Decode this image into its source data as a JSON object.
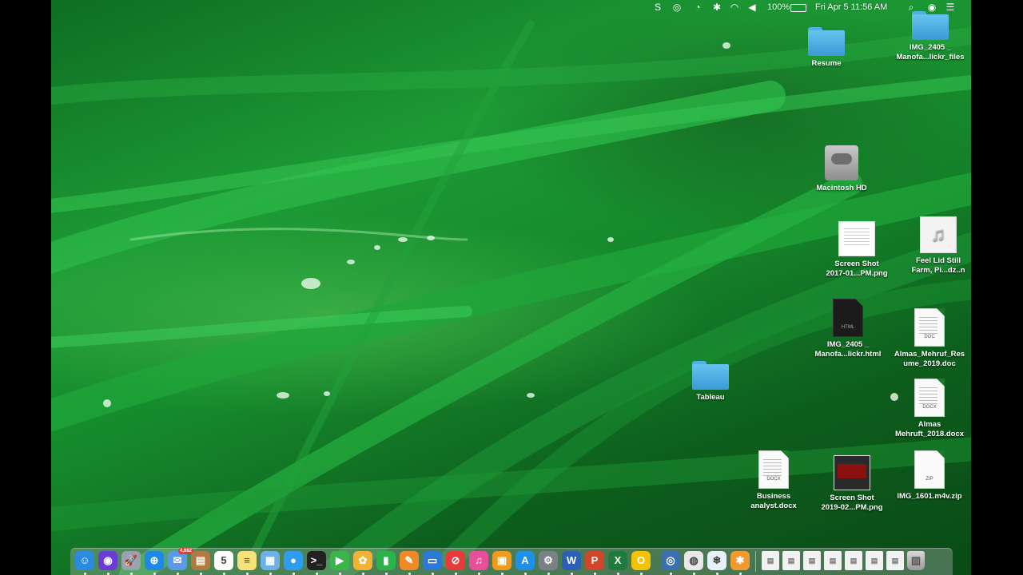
{
  "menubar": {
    "battery": "100%",
    "datetime": "Fri Apr 5  11:56 AM"
  },
  "desktop": {
    "icons": [
      {
        "label": "Resume",
        "type": "folder"
      },
      {
        "label": "IMG_2405 _\nManofa...lickr_files",
        "type": "folder"
      },
      {
        "label": "Macintosh HD",
        "type": "drive"
      },
      {
        "label": "Screen Shot\n2017-01...PM.png",
        "type": "screenshot"
      },
      {
        "label": "Feel Lid Still\nFarm, Pi...dz..n",
        "type": "audio"
      },
      {
        "label": "IMG_2405 _\nManofa...lickr.html",
        "type": "html"
      },
      {
        "label": "Almas_Mehruf_Res\nume_2019.doc",
        "type": "doc",
        "tag": "DOC"
      },
      {
        "label": "Tableau",
        "type": "folder"
      },
      {
        "label": "Almas\nMehruft_2018.docx",
        "type": "doc",
        "tag": "DOCX"
      },
      {
        "label": "Business\nanalyst.docx",
        "type": "doc",
        "tag": "DOCX"
      },
      {
        "label": "Screen Shot\n2019-02...PM.png",
        "type": "screenshot"
      },
      {
        "label": "IMG_1601.m4v.zip",
        "type": "zip",
        "tag": "ZIP"
      }
    ]
  },
  "dock": {
    "apps": [
      {
        "name": "finder-icon",
        "color": "#2a8be0",
        "glyph": "☺"
      },
      {
        "name": "siri-icon",
        "color": "#6a3bd6",
        "glyph": "◉"
      },
      {
        "name": "launchpad-icon",
        "color": "#9aa3ad",
        "glyph": "🚀"
      },
      {
        "name": "safari-icon",
        "color": "#1e88e5",
        "glyph": "⊕"
      },
      {
        "name": "mail-icon",
        "color": "#5a9be8",
        "glyph": "✉",
        "badge": "4,682"
      },
      {
        "name": "contacts-icon",
        "color": "#b07b43",
        "glyph": "▤"
      },
      {
        "name": "calendar-icon",
        "color": "#ffffff",
        "glyph": "5"
      },
      {
        "name": "notes-icon",
        "color": "#f7e27a",
        "glyph": "≡"
      },
      {
        "name": "preview-icon",
        "color": "#6fb0e6",
        "glyph": "▦"
      },
      {
        "name": "messages-icon",
        "color": "#2e9cf0",
        "glyph": "●"
      },
      {
        "name": "terminal-icon",
        "color": "#222222",
        "glyph": ">_"
      },
      {
        "name": "facetime-icon",
        "color": "#3bb54a",
        "glyph": "▶"
      },
      {
        "name": "photos-icon",
        "color": "#f2b233",
        "glyph": "✿"
      },
      {
        "name": "numbers-icon",
        "color": "#2eb34a",
        "glyph": "▮"
      },
      {
        "name": "pages-icon",
        "color": "#f08a24",
        "glyph": "✎"
      },
      {
        "name": "keynote-icon",
        "color": "#2a7ad6",
        "glyph": "▭"
      },
      {
        "name": "news-icon",
        "color": "#e83a3a",
        "glyph": "⊘"
      },
      {
        "name": "itunes-icon",
        "color": "#e84f9a",
        "glyph": "♫"
      },
      {
        "name": "ibooks-icon",
        "color": "#f29a1e",
        "glyph": "▣"
      },
      {
        "name": "app-store-icon",
        "color": "#1f8fe8",
        "glyph": "A"
      },
      {
        "name": "system-preferences-icon",
        "color": "#7c8088",
        "glyph": "⚙"
      },
      {
        "name": "word-icon",
        "color": "#2b5fb8",
        "glyph": "W"
      },
      {
        "name": "powerpoint-icon",
        "color": "#d0462a",
        "glyph": "P"
      },
      {
        "name": "excel-icon",
        "color": "#1f7a3e",
        "glyph": "X"
      },
      {
        "name": "outlook-icon",
        "color": "#f2c400",
        "glyph": "O"
      },
      {
        "name": "quicktime-icon",
        "color": "#3a6fb0",
        "glyph": "◎"
      },
      {
        "name": "chrome-icon",
        "color": "#e8e8e8",
        "glyph": "◍"
      },
      {
        "name": "snowflake-app-icon",
        "color": "#e8f1fa",
        "glyph": "❄"
      },
      {
        "name": "tableau-app-icon",
        "color": "#f29a2e",
        "glyph": "✱"
      }
    ],
    "stack": [
      {
        "name": "downloads-stack-icon"
      },
      {
        "name": "recent-doc-1-icon"
      },
      {
        "name": "recent-doc-2-icon"
      },
      {
        "name": "recent-doc-3-icon"
      },
      {
        "name": "recent-doc-4-icon"
      },
      {
        "name": "recent-doc-5-icon"
      },
      {
        "name": "recent-doc-6-icon"
      },
      {
        "name": "trash-icon"
      }
    ]
  }
}
